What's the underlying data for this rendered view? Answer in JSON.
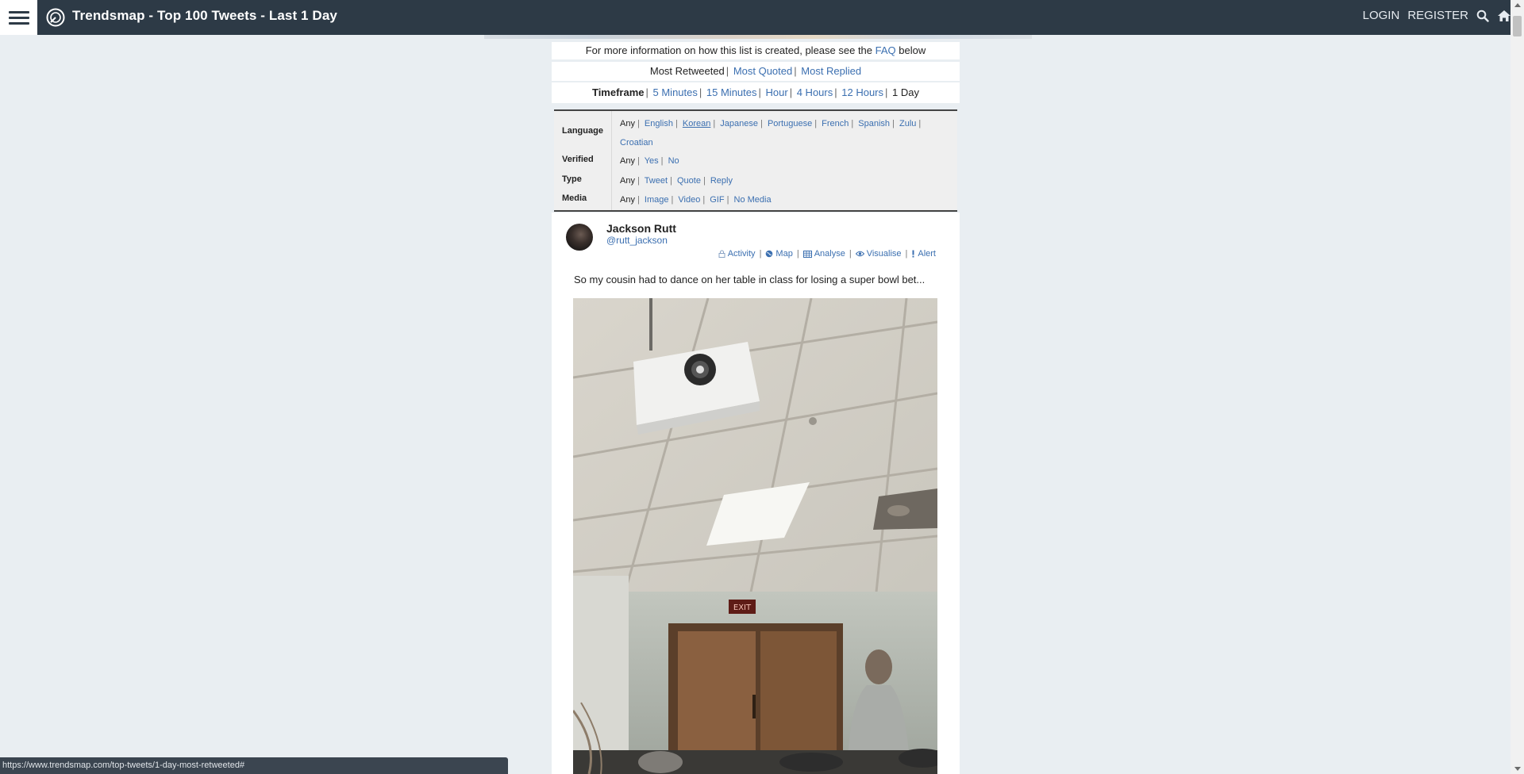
{
  "header": {
    "title": "Trendsmap - Top 100 Tweets - Last 1 Day",
    "login": "LOGIN",
    "register": "REGISTER",
    "icons": [
      "hamburger-menu-icon",
      "trendsmap-logo-icon",
      "search-icon",
      "home-icon"
    ]
  },
  "info": {
    "prefix": "For more information on how this list is created, please see the",
    "faq": "FAQ",
    "suffix": "below"
  },
  "sort": {
    "current": "Most Retweeted",
    "quoted": "Most Quoted",
    "replied": "Most Replied"
  },
  "timeframe": {
    "label": "Timeframe",
    "options": [
      "5 Minutes",
      "15 Minutes",
      "Hour",
      "4 Hours",
      "12 Hours"
    ],
    "current": "1 Day"
  },
  "filters": {
    "language": {
      "label": "Language",
      "current": "Any",
      "options": [
        "English",
        "Korean",
        "Japanese",
        "Portuguese",
        "French",
        "Spanish",
        "Zulu",
        "Croatian"
      ],
      "selected": "Korean"
    },
    "verified": {
      "label": "Verified",
      "current": "Any",
      "options": [
        "Yes",
        "No"
      ]
    },
    "type": {
      "label": "Type",
      "current": "Any",
      "options": [
        "Tweet",
        "Quote",
        "Reply"
      ]
    },
    "media": {
      "label": "Media",
      "current": "Any",
      "options": [
        "Image",
        "Video",
        "GIF",
        "No Media"
      ]
    }
  },
  "tweet": {
    "author_name": "Jackson Rutt",
    "author_handle": "@rutt_jackson",
    "actions": {
      "activity": "Activity",
      "map": "Map",
      "analyse": "Analyse",
      "visualise": "Visualise",
      "alert": "Alert"
    },
    "text": "So my cousin had to dance on her table in class for losing a super bowl bet...",
    "exit_sign": "EXIT"
  },
  "status_bar": {
    "url": "https://www.trendsmap.com/top-tweets/1-day-most-retweeted#"
  }
}
